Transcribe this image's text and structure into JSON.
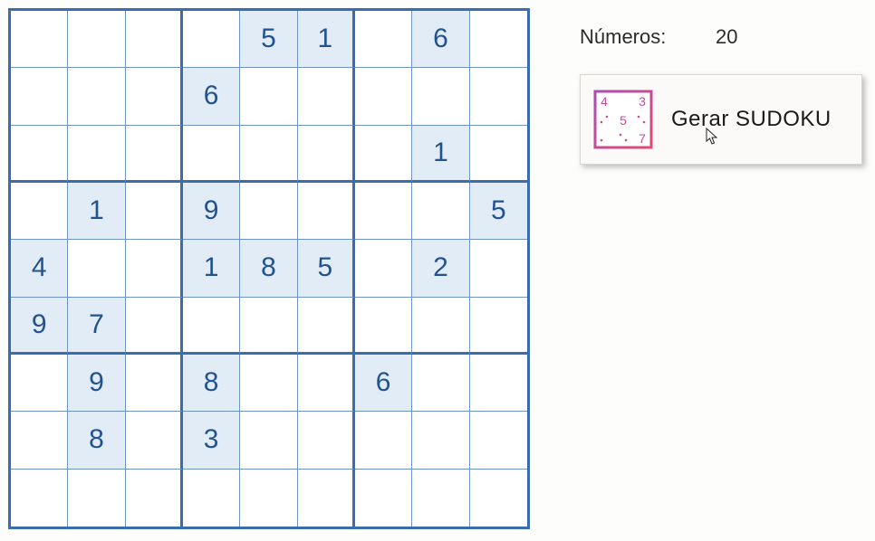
{
  "sudoku": {
    "grid": [
      [
        null,
        null,
        null,
        null,
        5,
        1,
        null,
        6,
        null
      ],
      [
        null,
        null,
        null,
        6,
        null,
        null,
        null,
        null,
        null
      ],
      [
        null,
        null,
        null,
        null,
        null,
        null,
        null,
        1,
        null
      ],
      [
        null,
        1,
        null,
        9,
        null,
        null,
        null,
        null,
        5
      ],
      [
        4,
        null,
        null,
        1,
        8,
        5,
        null,
        2,
        null
      ],
      [
        9,
        7,
        null,
        null,
        null,
        null,
        null,
        null,
        null
      ],
      [
        null,
        9,
        null,
        8,
        null,
        null,
        6,
        null,
        null
      ],
      [
        null,
        8,
        null,
        3,
        null,
        null,
        null,
        null,
        null
      ],
      [
        null,
        null,
        null,
        null,
        null,
        null,
        null,
        null,
        null
      ]
    ]
  },
  "side": {
    "count_label": "Números:",
    "count_value": "20",
    "generate_button_label": "Gerar SUDOKU"
  },
  "colors": {
    "grid_border": "#3a6db0",
    "cell_border": "#6f93c4",
    "given_bg": "#e1ecf7",
    "digit": "#23538f",
    "icon_accent": "#d84a7e"
  }
}
